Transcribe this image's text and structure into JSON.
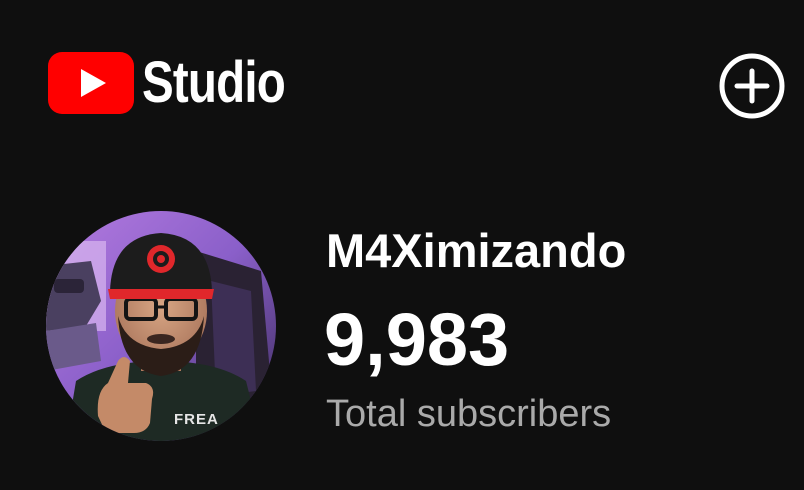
{
  "app": {
    "logo_text": "Studio",
    "logo_icon": "youtube-play-icon",
    "create_icon": "plus-circle-icon",
    "colors": {
      "background": "#0f0f0f",
      "brand_red": "#ff0000",
      "text_primary": "#ffffff",
      "text_secondary": "#aaaaaa"
    }
  },
  "channel": {
    "name": "M4Ximizando",
    "subscriber_count": "9,983",
    "subscriber_label": "Total subscribers",
    "avatar_cap_text": "",
    "avatar_shirt_text": "FREA"
  }
}
